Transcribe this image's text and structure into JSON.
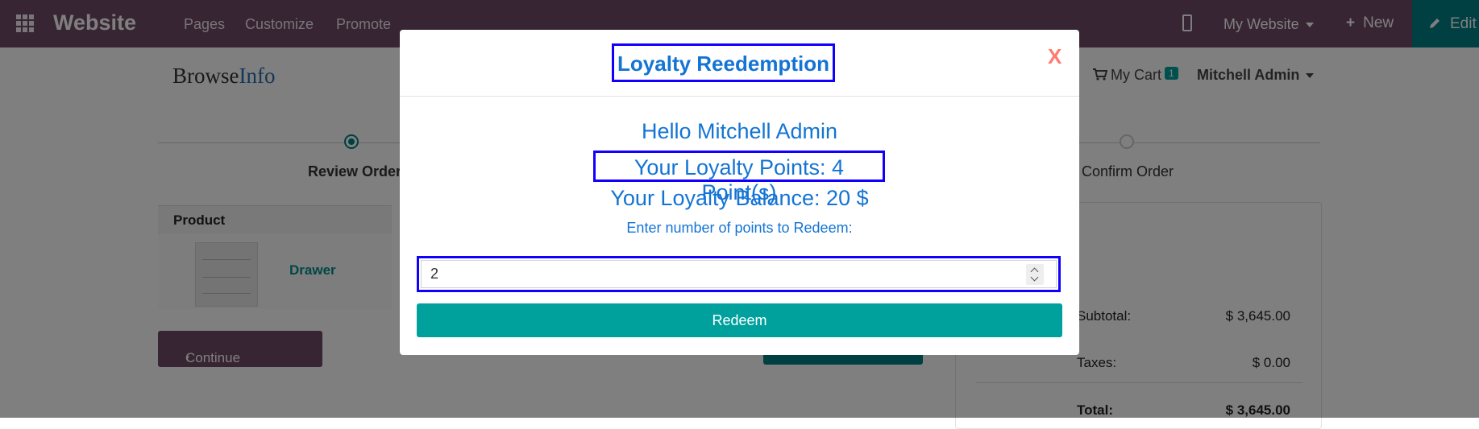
{
  "topbar": {
    "brand": "Website",
    "menu": [
      "Pages",
      "Customize",
      "Promote"
    ],
    "my_website": "My Website",
    "new_label": "New",
    "edit_label": "Edit"
  },
  "shop": {
    "logo_part1": "Browse",
    "logo_part2": "Info",
    "cart_label": "My Cart",
    "cart_count": "1",
    "user_name": "Mitchell Admin",
    "steps": [
      "Review Order",
      "Confirm Order"
    ],
    "product_header": "Product",
    "product_name": "Drawer",
    "continue_label": "Continue Shopping",
    "summary": {
      "subtotal_label": "Subtotal:",
      "subtotal_value": "$ 3,645.00",
      "taxes_label": "Taxes:",
      "taxes_value": "$ 0.00",
      "total_label": "Total:",
      "total_value": "$ 3,645.00"
    }
  },
  "modal": {
    "title": "Loyalty Reedemption",
    "close": "X",
    "hello": "Hello Mitchell Admin",
    "points": "Your Loyalty Points: 4 Point(s)",
    "balance": "Your Loyalty Balance: 20 $",
    "prompt": "Enter number of points to Redeem:",
    "input_value": "2",
    "redeem_label": "Redeem"
  },
  "colors": {
    "topbar": "#714B67",
    "accent": "#00A09D",
    "highlight_border": "#1200ff",
    "modal_text": "#1474d4"
  }
}
